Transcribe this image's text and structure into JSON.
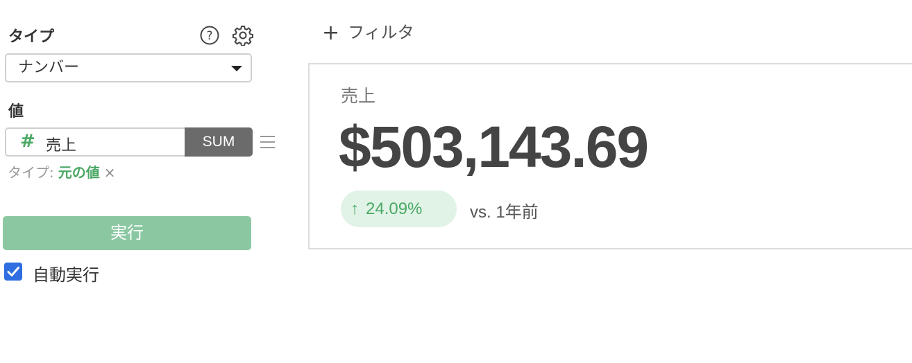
{
  "sidebar": {
    "type_label": "タイプ",
    "type_select": {
      "value": "ナンバー"
    },
    "value_label": "値",
    "value_field": {
      "name": "売上",
      "aggregation": "SUM"
    },
    "subtype": {
      "key": "タイプ:",
      "value": "元の値",
      "remove": "×"
    },
    "run_button": "実行",
    "auto_run": {
      "label": "自動実行",
      "checked": true
    }
  },
  "filter": {
    "add_label": "フィルタ"
  },
  "card": {
    "title": "売上",
    "value": "$503,143.69",
    "change": "24.09%",
    "compare": "vs. 1年前"
  },
  "colors": {
    "positive": "#4aa865",
    "run_button": "#8bc8a2",
    "checkbox": "#2f6de0"
  },
  "icons": [
    "help-icon",
    "gear-icon",
    "chevron-down-icon",
    "hash-icon",
    "drag-handle-icon",
    "plus-icon",
    "arrow-up-icon",
    "check-icon",
    "close-icon"
  ]
}
